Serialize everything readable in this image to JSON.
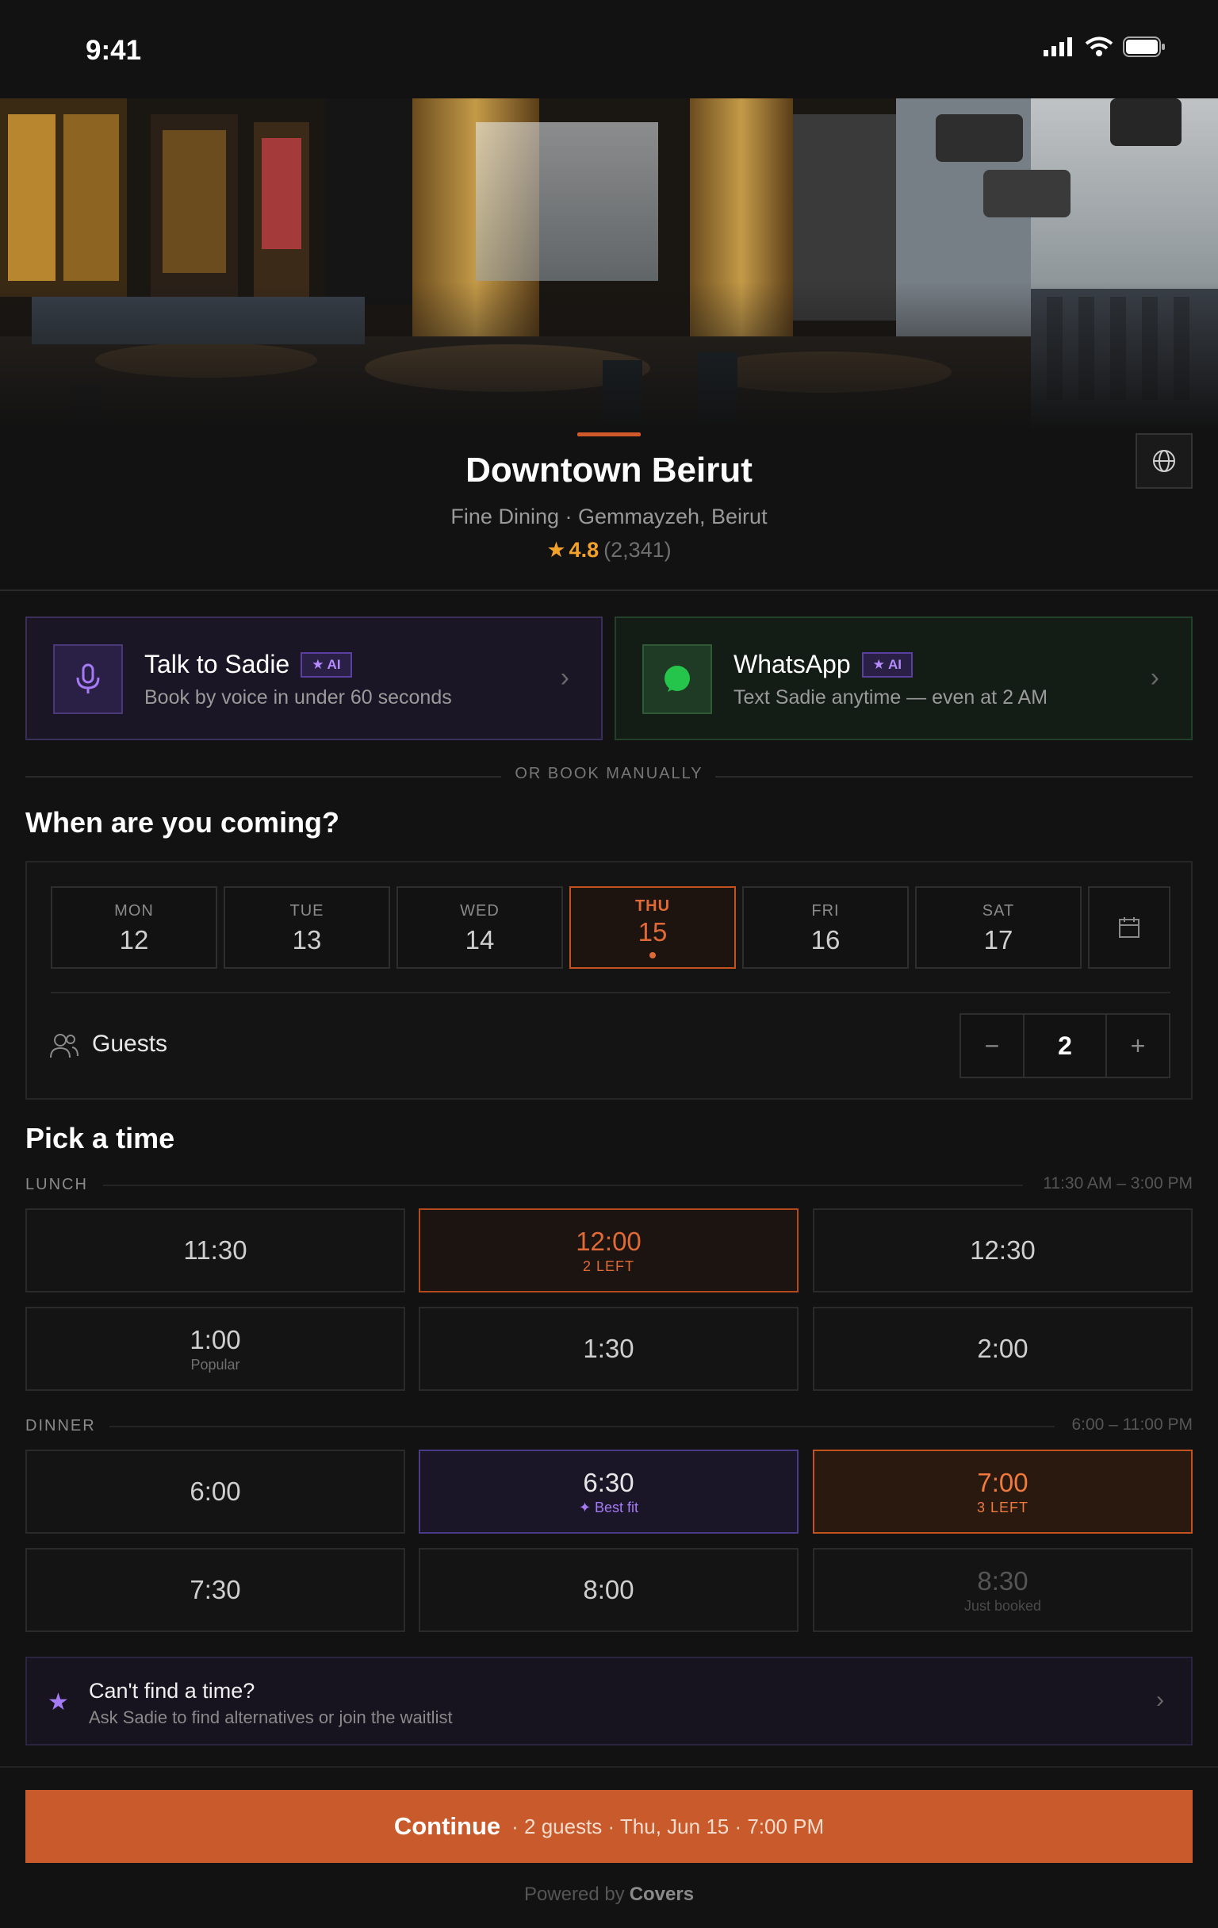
{
  "status": {
    "time": "9:41"
  },
  "venue": {
    "name": "Downtown Beirut",
    "subtitle": "Fine Dining · Gemmayzeh, Beirut",
    "rating": "4.8",
    "reviews": "(2,341)",
    "star": "★"
  },
  "agents": {
    "voice": {
      "title": "Talk to Sadie",
      "badge": "★ AI",
      "desc": "Book by voice in under 60 seconds",
      "chevron": "›"
    },
    "whatsapp": {
      "title": "WhatsApp",
      "badge": "★ AI",
      "desc": "Text Sadie anytime — even at 2 AM",
      "chevron": "›"
    }
  },
  "or_book": "OR BOOK MANUALLY",
  "when": {
    "title": "When are you coming?",
    "days": [
      {
        "dow": "MON",
        "num": "12"
      },
      {
        "dow": "TUE",
        "num": "13"
      },
      {
        "dow": "WED",
        "num": "14"
      },
      {
        "dow": "THU",
        "num": "15"
      },
      {
        "dow": "FRI",
        "num": "16"
      },
      {
        "dow": "SAT",
        "num": "17"
      }
    ],
    "selected_day": "THU",
    "guests_label": "Guests",
    "guests_value": "2",
    "minus": "−",
    "plus": "+"
  },
  "pick": {
    "title": "Pick a time",
    "lunch": {
      "label": "LUNCH",
      "range": "11:30 AM – 3:00 PM",
      "slots": [
        {
          "time": "11:30",
          "note": ""
        },
        {
          "time": "12:00",
          "note": "2 LEFT"
        },
        {
          "time": "12:30",
          "note": ""
        },
        {
          "time": "1:00",
          "note": "Popular"
        },
        {
          "time": "1:30",
          "note": ""
        },
        {
          "time": "2:00",
          "note": ""
        }
      ]
    },
    "dinner": {
      "label": "DINNER",
      "range": "6:00 – 11:00 PM",
      "slots": [
        {
          "time": "6:00",
          "note": ""
        },
        {
          "time": "6:30",
          "note": "✦ Best fit"
        },
        {
          "time": "7:00",
          "note": "3 LEFT"
        },
        {
          "time": "7:30",
          "note": ""
        },
        {
          "time": "8:00",
          "note": ""
        },
        {
          "time": "8:30",
          "note": "Just booked"
        }
      ]
    }
  },
  "waitlist": {
    "icon": "★",
    "title": "Can't find a time?",
    "sub": "Ask Sadie to find alternatives or join the waitlist",
    "chevron": "›"
  },
  "cta": {
    "label": "Continue",
    "summary": "· 2 guests · Thu, Jun 15 · 7:00 PM"
  },
  "footer": {
    "powered": "Powered by",
    "brand": "Covers"
  },
  "colors": {
    "accent": "#c85a2c",
    "ai_purple": "#a57af5",
    "whatsapp_green": "#25c44a",
    "star": "#f2a12a"
  }
}
